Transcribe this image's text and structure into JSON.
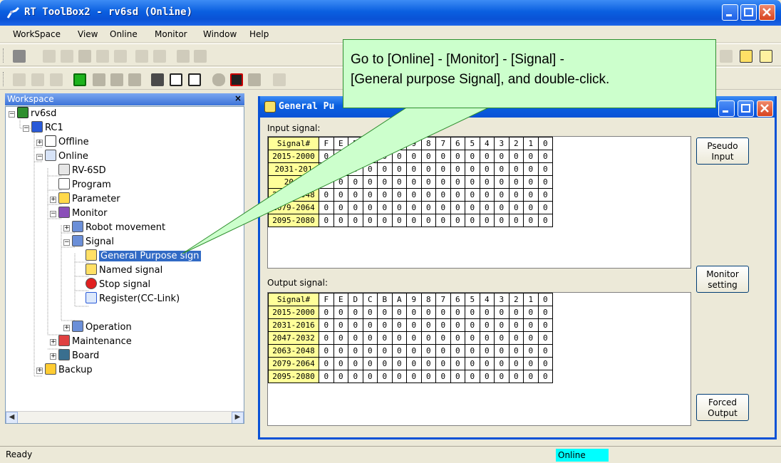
{
  "window": {
    "title": "RT ToolBox2 - rv6sd (Online)"
  },
  "menu": [
    "WorkSpace",
    "View",
    "Online",
    "Monitor",
    "Window",
    "Help"
  ],
  "workspace": {
    "header": "Workspace",
    "close": "×",
    "tree": [
      {
        "label": "rv6sd",
        "icon": "project-icon"
      },
      {
        "label": "RC1",
        "icon": "robot-controller-icon"
      },
      {
        "label": "Offline",
        "icon": "offline-icon"
      },
      {
        "label": "Online",
        "icon": "online-icon"
      },
      {
        "label": "RV-6SD",
        "icon": "robot-arm-icon"
      },
      {
        "label": "Program",
        "icon": "program-icon"
      },
      {
        "label": "Parameter",
        "icon": "parameter-icon"
      },
      {
        "label": "Monitor",
        "icon": "monitor-icon"
      },
      {
        "label": "Robot movement",
        "icon": "glasses-icon"
      },
      {
        "label": "Signal",
        "icon": "glasses-icon"
      },
      {
        "label": "General Purpose sign",
        "icon": "signal-bulb-icon"
      },
      {
        "label": "Named signal",
        "icon": "signal-bulb-icon"
      },
      {
        "label": "Stop signal",
        "icon": "stop-signal-icon"
      },
      {
        "label": "Register(CC-Link)",
        "icon": "cc-link-icon"
      },
      {
        "label": "Operation",
        "icon": "glasses-icon"
      },
      {
        "label": "Maintenance",
        "icon": "maintenance-icon"
      },
      {
        "label": "Board",
        "icon": "board-icon"
      },
      {
        "label": "Backup",
        "icon": "backup-icon"
      }
    ]
  },
  "child_window": {
    "title": "General Pu",
    "input_label": "Input signal:",
    "output_label": "Output signal:",
    "header_first": "Signal#",
    "bits": [
      "F",
      "E",
      "D",
      "C",
      "B",
      "A",
      "9",
      "8",
      "7",
      "6",
      "5",
      "4",
      "3",
      "2",
      "1",
      "0"
    ],
    "input_rows": [
      "2015-2000",
      "2031-201",
      "2047",
      "2063-2048",
      "2079-2064",
      "2095-2080"
    ],
    "output_rows": [
      "2015-2000",
      "2031-2016",
      "2047-2032",
      "2063-2048",
      "2079-2064",
      "2095-2080"
    ],
    "value": "0",
    "buttons": {
      "pseudo": "Pseudo Input",
      "monitor": "Monitor setting",
      "forced": "Forced Output"
    }
  },
  "callout": {
    "line1": "Go to [Online] - [Monitor] - [Signal] -",
    "line2": "[General purpose Signal], and double-click."
  },
  "status": {
    "left": "Ready",
    "online": "Online"
  },
  "colors": {
    "title_blue": "#0a52d6",
    "grid_header": "#ffff99",
    "callout_bg": "#ccffcc",
    "status_online": "#00ffff"
  }
}
